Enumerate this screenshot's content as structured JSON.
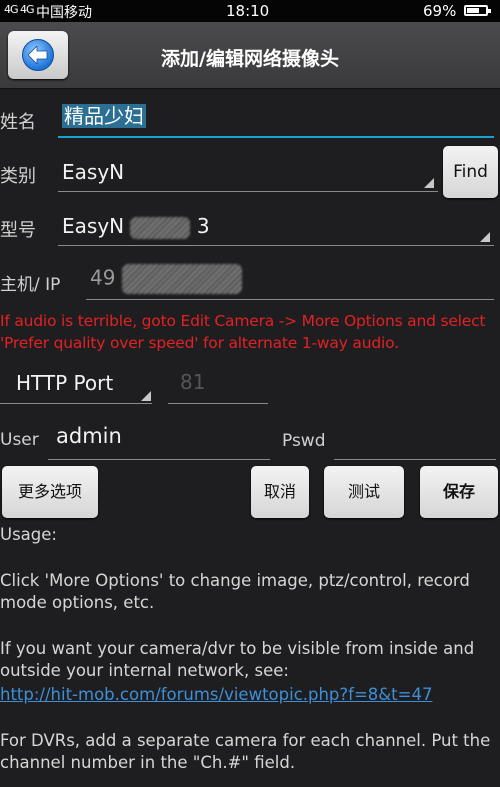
{
  "status_bar": {
    "signal": "4G 4G",
    "carrier": "中国移动",
    "time": "18:10",
    "battery": "69%",
    "battery_level": 0.69
  },
  "header": {
    "title": "添加/编辑网络摄像头",
    "back_icon": "arrow-left-icon"
  },
  "form": {
    "name_label": "姓名",
    "name_value": "精品少妇",
    "category_label": "类别",
    "category_value": "EasyN",
    "find_button": "Find",
    "model_label": "型号",
    "model_value": "EasyN",
    "model_suffix": "3",
    "host_label": "主机/ IP",
    "host_value_prefix": "49",
    "warning": "If audio is terrible, goto Edit Camera -> More Options and select 'Prefer quality over speed' for alternate 1-way audio.",
    "port_select": "HTTP Port",
    "port_value": "81",
    "user_label": "User",
    "user_value": "admin",
    "pswd_label": "Pswd",
    "pswd_value": ""
  },
  "buttons": {
    "more_options": "更多选项",
    "cancel": "取消",
    "test": "测试",
    "save": "保存"
  },
  "usage": {
    "title": "Usage:",
    "p1": "Click 'More Options' to change image, ptz/control, record mode options, etc.",
    "p2": "If you want your camera/dvr to be visible from inside and outside your internal network, see:",
    "link": "http://hit-mob.com/forums/viewtopic.php?f=8&t=47",
    "p3": "For DVRs, add a separate camera for each channel. Put the channel number in the \"Ch.#\" field."
  }
}
